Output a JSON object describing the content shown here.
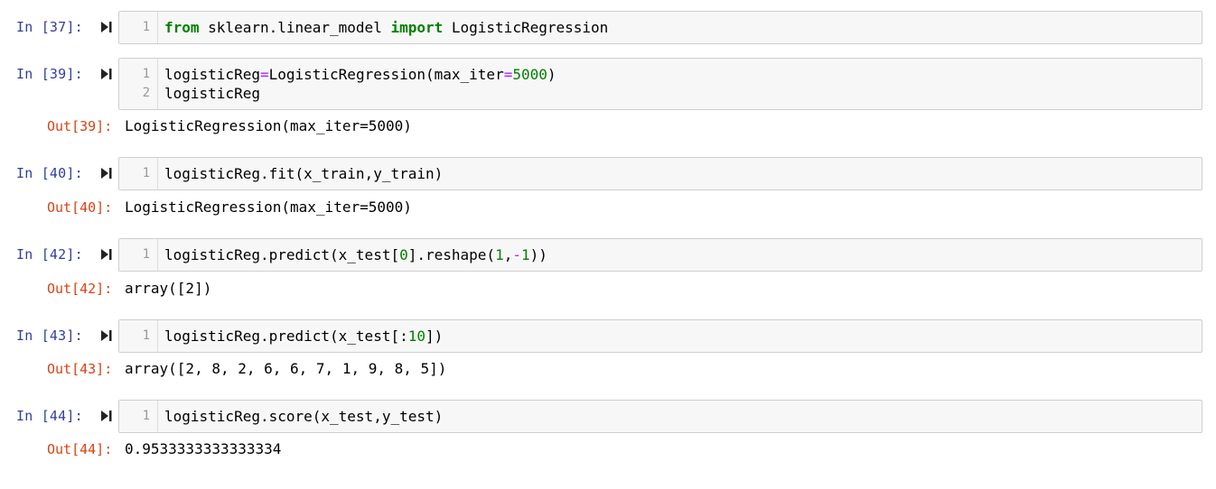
{
  "cells": [
    {
      "in_prompt": "In [37]:",
      "line_numbers": [
        "1"
      ],
      "code": [
        [
          {
            "t": "from",
            "c": "kw"
          },
          {
            "t": " sklearn.linear_model ",
            "c": ""
          },
          {
            "t": "import",
            "c": "kw"
          },
          {
            "t": " LogisticRegression",
            "c": ""
          }
        ]
      ],
      "out_prompt": "",
      "output": ""
    },
    {
      "in_prompt": "In [39]:",
      "line_numbers": [
        "1",
        "2"
      ],
      "code": [
        [
          {
            "t": "logisticReg",
            "c": ""
          },
          {
            "t": "=",
            "c": "op"
          },
          {
            "t": "LogisticRegression(max_iter",
            "c": ""
          },
          {
            "t": "=",
            "c": "op"
          },
          {
            "t": "5000",
            "c": "num"
          },
          {
            "t": ")",
            "c": ""
          }
        ],
        [
          {
            "t": "logisticReg",
            "c": ""
          }
        ]
      ],
      "out_prompt": "Out[39]:",
      "output": "LogisticRegression(max_iter=5000)"
    },
    {
      "in_prompt": "In [40]:",
      "line_numbers": [
        "1"
      ],
      "code": [
        [
          {
            "t": "logisticReg.fit(x_train,y_train)",
            "c": ""
          }
        ]
      ],
      "out_prompt": "Out[40]:",
      "output": "LogisticRegression(max_iter=5000)"
    },
    {
      "in_prompt": "In [42]:",
      "line_numbers": [
        "1"
      ],
      "code": [
        [
          {
            "t": "logisticReg.predict(x_test[",
            "c": ""
          },
          {
            "t": "0",
            "c": "num"
          },
          {
            "t": "].reshape(",
            "c": ""
          },
          {
            "t": "1",
            "c": "num"
          },
          {
            "t": ",",
            "c": ""
          },
          {
            "t": "-",
            "c": "op"
          },
          {
            "t": "1",
            "c": "num"
          },
          {
            "t": "))",
            "c": ""
          }
        ]
      ],
      "out_prompt": "Out[42]:",
      "output": "array([2])"
    },
    {
      "in_prompt": "In [43]:",
      "line_numbers": [
        "1"
      ],
      "code": [
        [
          {
            "t": "logisticReg.predict(x_test[:",
            "c": ""
          },
          {
            "t": "10",
            "c": "num"
          },
          {
            "t": "])",
            "c": ""
          }
        ]
      ],
      "out_prompt": "Out[43]:",
      "output": "array([2, 8, 2, 6, 6, 7, 1, 9, 8, 5])"
    },
    {
      "in_prompt": "In [44]:",
      "line_numbers": [
        "1"
      ],
      "code": [
        [
          {
            "t": "logisticReg.score(x_test,y_test)",
            "c": ""
          }
        ]
      ],
      "out_prompt": "Out[44]:",
      "output": "0.9533333333333334"
    }
  ],
  "colors": {
    "in_prompt": "#303f9f",
    "out_prompt": "#d84315",
    "keyword": "#008000",
    "number": "#008000",
    "operator": "#aa22ff",
    "cell_background": "#f7f7f7",
    "cell_border": "#cfcfcf"
  },
  "icons": {
    "run": "run-cell-icon"
  }
}
